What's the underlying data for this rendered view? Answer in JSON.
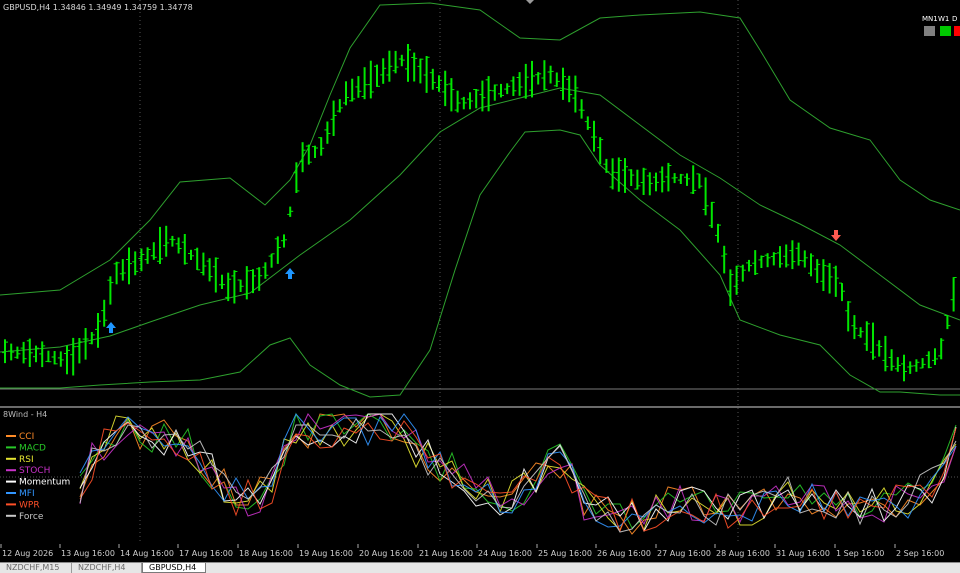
{
  "main_chart": {
    "title": "GBPUSD,H4  1.34846 1.34949 1.34759 1.34778",
    "timeframes": [
      {
        "label": "MN1",
        "color": "#808080"
      },
      {
        "label": "W1",
        "color": "#00c800"
      },
      {
        "label": "D",
        "color": "#ff0000"
      }
    ]
  },
  "indicator_panel": {
    "title": "8Wind - H4",
    "legend": [
      {
        "label": "CCI",
        "color": "#ff8c28"
      },
      {
        "label": "MACD",
        "color": "#28c828"
      },
      {
        "label": "RSI",
        "color": "#e6e632"
      },
      {
        "label": "STOCH",
        "color": "#c832c8"
      },
      {
        "label": "Momentum",
        "color": "#ffffff"
      },
      {
        "label": "MFI",
        "color": "#3296ff"
      },
      {
        "label": "WPR",
        "color": "#ff5028"
      },
      {
        "label": "Force",
        "color": "#c8c8c8"
      }
    ]
  },
  "time_axis": {
    "labels": [
      "12 Aug 2026",
      "13 Aug 16:00",
      "14 Aug 16:00",
      "17 Aug 16:00",
      "18 Aug 16:00",
      "19 Aug 16:00",
      "20 Aug 16:00",
      "21 Aug 16:00",
      "24 Aug 16:00",
      "25 Aug 16:00",
      "26 Aug 16:00",
      "27 Aug 16:00",
      "28 Aug 16:00",
      "31 Aug 16:00",
      "1 Sep 16:00",
      "2 Sep 16:00"
    ]
  },
  "tabs": [
    {
      "label": "NZDCHF,M15",
      "active": false
    },
    {
      "label": "NZDCHF,H4",
      "active": false
    },
    {
      "label": "GBPUSD,H4",
      "active": true
    }
  ],
  "colors": {
    "bar": "#00e600",
    "band": "#2ea02e",
    "up_arrow": "#1e96ff",
    "down_arrow": "#ff5a50",
    "grid": "#555555"
  }
}
